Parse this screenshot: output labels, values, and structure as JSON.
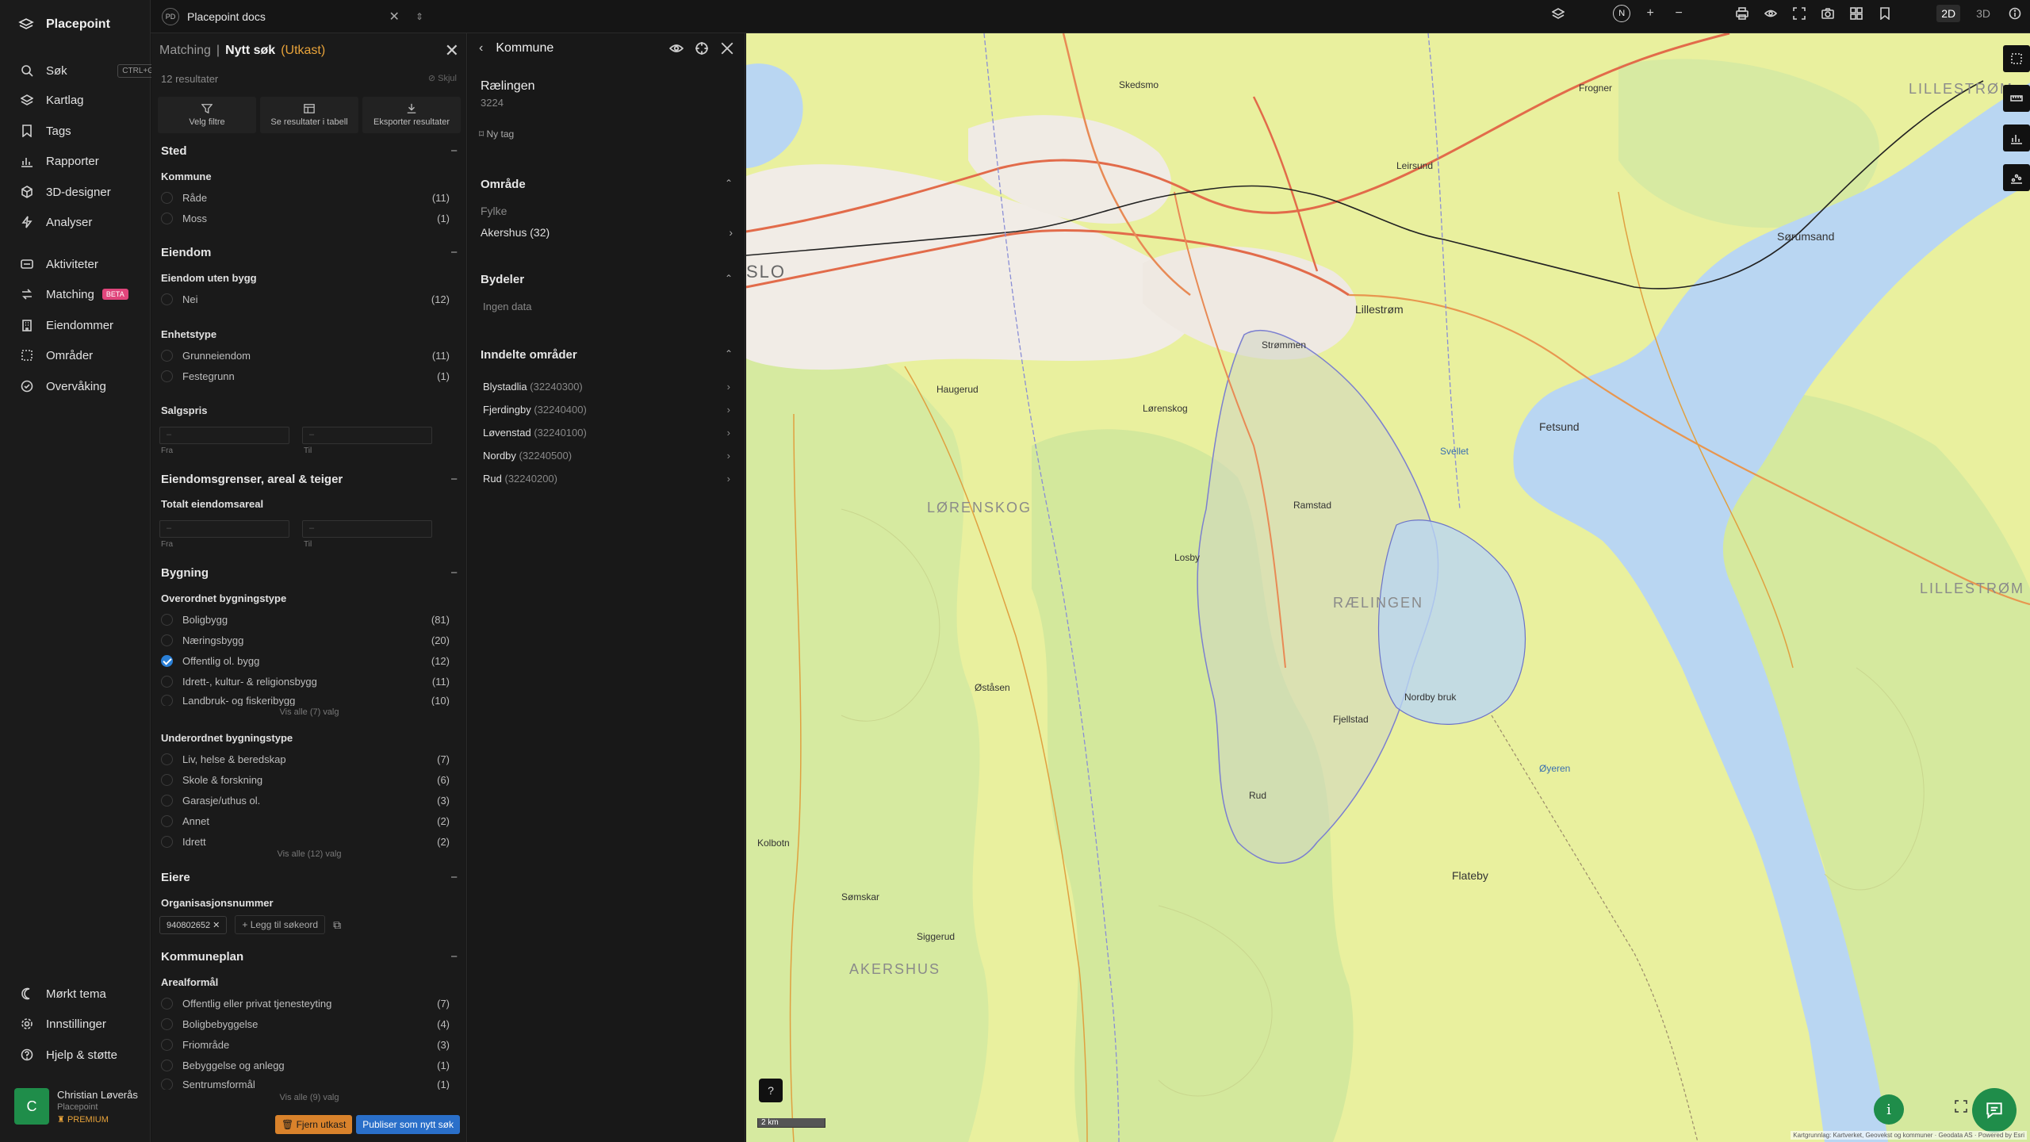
{
  "app": {
    "name": "Placepoint"
  },
  "nav": {
    "search": {
      "label": "Søk",
      "shortcut": "CTRL+G"
    },
    "items": [
      {
        "label": "Kartlag",
        "icon": "layers-icon"
      },
      {
        "label": "Tags",
        "icon": "bookmark-icon"
      },
      {
        "label": "Rapporter",
        "icon": "chart-icon"
      },
      {
        "label": "3D-designer",
        "icon": "cube-icon"
      },
      {
        "label": "Analyser",
        "icon": "bolt-icon"
      }
    ],
    "items2": [
      {
        "label": "Aktiviteter",
        "icon": "activity-icon"
      },
      {
        "label": "Matching",
        "icon": "match-icon",
        "badge": "BETA"
      },
      {
        "label": "Eiendommer",
        "icon": "building-icon"
      },
      {
        "label": "Områder",
        "icon": "area-icon"
      },
      {
        "label": "Overvåking",
        "icon": "monitor-icon"
      }
    ],
    "bottom": [
      {
        "label": "Mørkt tema",
        "icon": "moon-icon"
      },
      {
        "label": "Innstillinger",
        "icon": "gear-icon"
      },
      {
        "label": "Hjelp & støtte",
        "icon": "help-icon"
      }
    ],
    "user": {
      "initial": "C",
      "name": "Christian Løverås",
      "company": "Placepoint",
      "plan": "PREMIUM"
    }
  },
  "topbar": {
    "doc_badge": "PD",
    "doc_name": "Placepoint docs",
    "mode_2d": "2D",
    "mode_3d": "3D",
    "north": "N"
  },
  "filter": {
    "crumb_root": "Matching",
    "crumb_sep": "|",
    "title": "Nytt søk",
    "draft": "(Utkast)",
    "result_count": "12 resultater",
    "hide_label": "Skjul",
    "actions": {
      "filters": "Velg filtre",
      "table": "Se resultater i tabell",
      "export": "Eksporter resultater"
    },
    "sted": {
      "title": "Sted",
      "kommune_label": "Kommune",
      "options": [
        {
          "label": "Råde",
          "count": "(11)"
        },
        {
          "label": "Moss",
          "count": "(1)"
        }
      ]
    },
    "eiendom": {
      "title": "Eiendom",
      "uten_bygg_label": "Eiendom uten bygg",
      "uten_bygg_options": [
        {
          "label": "Nei",
          "count": "(12)"
        }
      ],
      "enhet_label": "Enhetstype",
      "enhet_options": [
        {
          "label": "Grunneiendom",
          "count": "(11)"
        },
        {
          "label": "Festegrunn",
          "count": "(1)"
        }
      ],
      "salgspris_label": "Salgspris",
      "from_placeholder": "–",
      "to_placeholder": "–",
      "from_label": "Fra",
      "to_label": "Til"
    },
    "grenser": {
      "title": "Eiendomsgrenser, areal & teiger",
      "areal_label": "Totalt eiendomsareal",
      "from_placeholder": "–",
      "to_placeholder": "–",
      "from_label": "Fra",
      "to_label": "Til"
    },
    "bygning": {
      "title": "Bygning",
      "overordnet_label": "Overordnet bygningstype",
      "overordnet_options": [
        {
          "label": "Boligbygg",
          "count": "(81)",
          "checked": false
        },
        {
          "label": "Næringsbygg",
          "count": "(20)",
          "checked": false
        },
        {
          "label": "Offentlig ol. bygg",
          "count": "(12)",
          "checked": true
        },
        {
          "label": "Idrett-, kultur- & religionsbygg",
          "count": "(11)",
          "checked": false
        },
        {
          "label": "Landbruk- og fiskeribygg",
          "count": "(10)",
          "checked": false
        }
      ],
      "overordnet_showall": "Vis alle (7) valg",
      "underordnet_label": "Underordnet bygningstype",
      "underordnet_options": [
        {
          "label": "Liv, helse & beredskap",
          "count": "(7)"
        },
        {
          "label": "Skole & forskning",
          "count": "(6)"
        },
        {
          "label": "Garasje/uthus ol.",
          "count": "(3)"
        },
        {
          "label": "Annet",
          "count": "(2)"
        },
        {
          "label": "Idrett",
          "count": "(2)"
        }
      ],
      "underordnet_showall": "Vis alle (12) valg"
    },
    "eiere": {
      "title": "Eiere",
      "org_label": "Organisasjonsnummer",
      "chip": "940802652",
      "add_keyword": "Legg til søkeord"
    },
    "kommuneplan": {
      "title": "Kommuneplan",
      "arealformal_label": "Arealformål",
      "options": [
        {
          "label": "Offentlig eller privat tjenesteyting",
          "count": "(7)"
        },
        {
          "label": "Boligbebyggelse",
          "count": "(4)"
        },
        {
          "label": "Friområde",
          "count": "(3)"
        },
        {
          "label": "Bebyggelse og anlegg",
          "count": "(1)"
        },
        {
          "label": "Sentrumsformål",
          "count": "(1)"
        }
      ],
      "showall": "Vis alle (9) valg"
    },
    "remove_draft": "Fjern utkast",
    "publish": "Publiser som nytt søk"
  },
  "kommune": {
    "header": "Kommune",
    "name": "Rælingen",
    "code": "3224",
    "new_tag": "Ny tag",
    "omrade_title": "Område",
    "fylke_label": "Fylke",
    "fylke_value": "Akershus",
    "fylke_code": "(32)",
    "bydeler_title": "Bydeler",
    "bydeler_empty": "Ingen data",
    "inndelte_title": "Inndelte områder",
    "areas": [
      {
        "name": "Blystadlia",
        "code": "(32240300)"
      },
      {
        "name": "Fjerdingby",
        "code": "(32240400)"
      },
      {
        "name": "Løvenstad",
        "code": "(32240100)"
      },
      {
        "name": "Nordby",
        "code": "(32240500)"
      },
      {
        "name": "Rud",
        "code": "(32240200)"
      }
    ]
  },
  "map": {
    "scale": "2 km",
    "attribution": "Kartgrunnlag: Kartverket, Geovekst og kommuner · Geodata AS · Powered by Esri",
    "labels": {
      "lillestrom": "LILLESTRØM",
      "lillestrom2": "LILLESTRØM",
      "lorenskog": "LØRENSKOG",
      "raelingen": "RÆLINGEN",
      "akershus": "AKERSHUS",
      "oslo": "SLO",
      "lillestrom_town": "Lillestrøm",
      "strommen": "Strømmen",
      "lorenskog_town": "Lørenskog",
      "fetsund": "Fetsund",
      "sorumsand": "Sørumsand",
      "skedsmo": "Skedsmo",
      "frogner": "Frogner",
      "oyeren": "Øyeren",
      "sveile": "Svellet",
      "nordby": "Nordby bruk",
      "flateby": "Flateby",
      "enebakk": "Øståsen",
      "siggerud": "Siggerud",
      "fjellstad": "Fjellstad",
      "rud": "Rud",
      "somskar": "Sømskar",
      "kolbotn": "Kolbotn",
      "leirsund": "Leirsund",
      "hauger": "Haugerud",
      "ramstad": "Ramstad",
      "losby": "Losby"
    }
  }
}
